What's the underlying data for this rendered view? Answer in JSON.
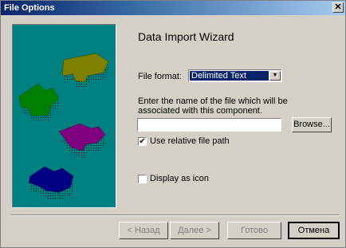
{
  "window": {
    "title": "File Options"
  },
  "wizard": {
    "heading": "Data Import Wizard",
    "file_format_label": "File format:",
    "file_format_value": "Delimited Text",
    "file_name_prompt": "Enter the name of the file which will be associated with this component.",
    "file_name_value": "",
    "browse_label": "Browse...",
    "use_relative_label": "Use relative file path",
    "use_relative_checked": true,
    "display_icon_label": "Display as icon",
    "display_icon_checked": false
  },
  "buttons": {
    "back": "< Назад",
    "next": "Далее >",
    "finish": "Готово",
    "cancel": "Отмена"
  },
  "colors": {
    "panel": "#008080",
    "selection": "#0a246a",
    "titlebar": "#0a246a"
  }
}
